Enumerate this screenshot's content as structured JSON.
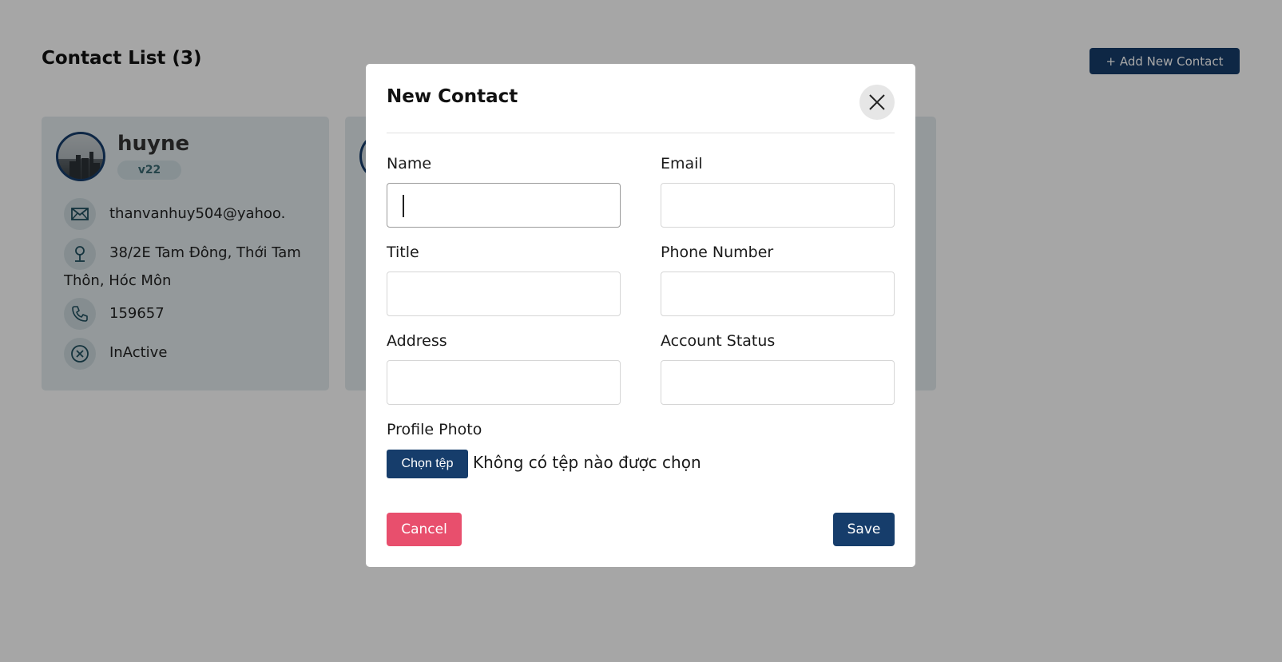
{
  "page": {
    "title": "Contact List (3)",
    "add_button_label": "+ Add New Contact"
  },
  "contacts": [
    {
      "name": "huyne",
      "tag": "v22",
      "email": "thanvanhuy504@yahoo.",
      "address_line1": "38/2E Tam Đông, Thới Tam",
      "address_line2": "Thôn, Hóc Môn",
      "phone": "159657",
      "status": "InActive"
    }
  ],
  "modal": {
    "title": "New Contact",
    "fields": {
      "name": {
        "label": "Name",
        "value": ""
      },
      "email": {
        "label": "Email",
        "value": ""
      },
      "title": {
        "label": "Title",
        "value": ""
      },
      "phone": {
        "label": "Phone Number",
        "value": ""
      },
      "address": {
        "label": "Address",
        "value": ""
      },
      "status": {
        "label": "Account Status",
        "value": ""
      }
    },
    "photo": {
      "label": "Profile Photo",
      "button_label": "Chọn tệp",
      "status_text": "Không có tệp nào được chọn"
    },
    "cancel_label": "Cancel",
    "save_label": "Save"
  },
  "colors": {
    "primary": "#163d6b",
    "danger": "#e84f6d",
    "card_bg": "#e3ecef",
    "overlay": "rgba(0,0,0,0.35)"
  }
}
